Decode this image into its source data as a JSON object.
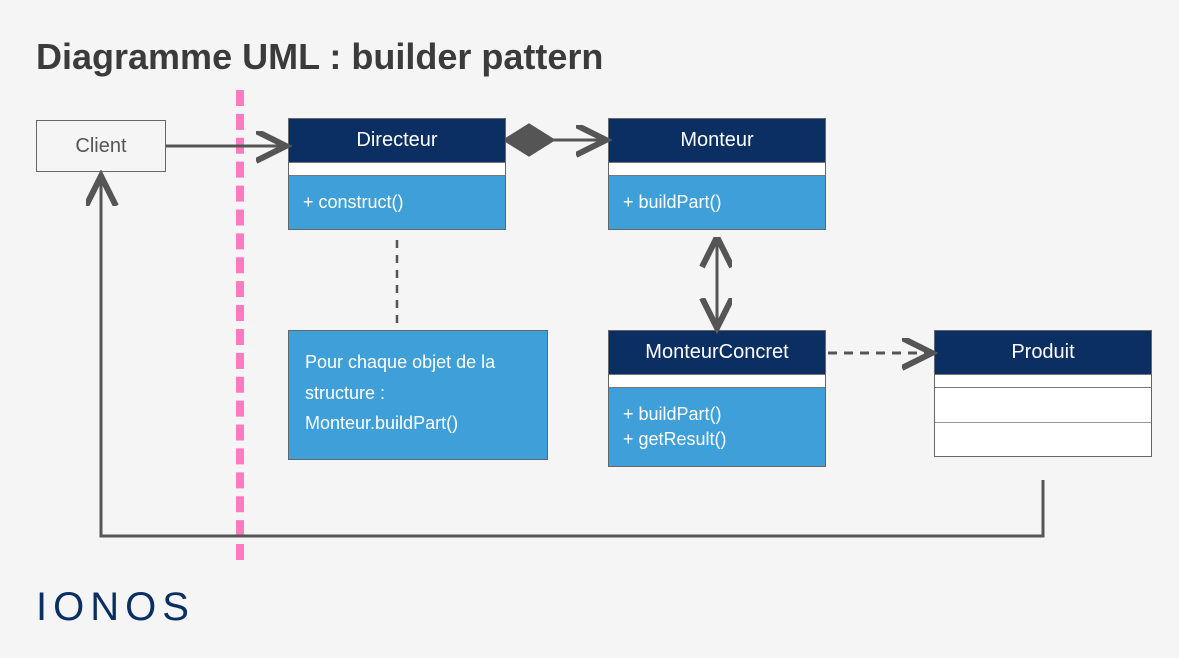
{
  "title": "Diagramme UML : builder pattern",
  "logo": "IONOS",
  "client": {
    "label": "Client"
  },
  "directeur": {
    "name": "Directeur",
    "method": "+ construct()"
  },
  "monteur": {
    "name": "Monteur",
    "method": "+ buildPart()"
  },
  "concret": {
    "name": "MonteurConcret",
    "method1": "+ buildPart()",
    "method2": "+ getResult()"
  },
  "produit": {
    "name": "Produit"
  },
  "note": {
    "line1": "Pour chaque objet de la",
    "line2": "structure :",
    "line3": "Monteur.buildPart()"
  }
}
